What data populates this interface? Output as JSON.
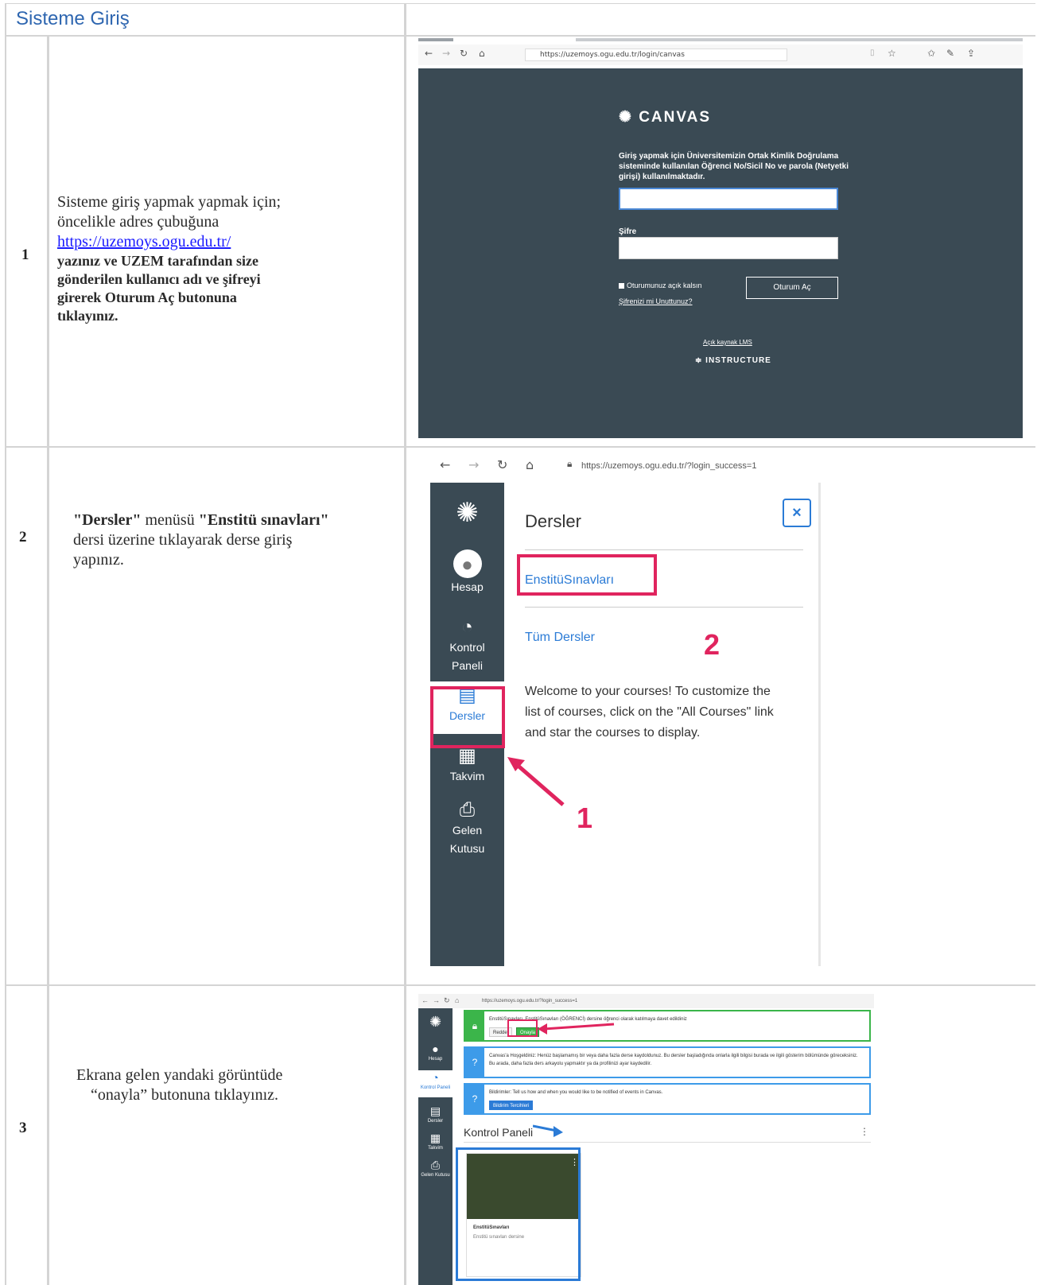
{
  "section": {
    "title": "Sisteme Giriş"
  },
  "steps": [
    {
      "number": "1"
    },
    {
      "number": "2"
    },
    {
      "number": "3"
    }
  ],
  "step1": {
    "line1": "Sisteme giriş yapmak yapmak için;",
    "line2": "öncelikle adres çubuğuna",
    "link": "https://uzemoys.ogu.edu.tr/",
    "line3": "yazınız ve UZEM tarafından size",
    "line4": "gönderilen kullanıcı adı ve şifreyi",
    "line5": "girerek Oturum Aç butonuna",
    "line6": "tıklayınız.",
    "browser": {
      "url": "https://uzemoys.ogu.edu.tr/login/canvas",
      "logo": "CANVAS",
      "description": "Giriş yapmak için Üniversitemizin Ortak Kimlik Doğrulama sisteminde kullanılan Öğrenci No/Sicil No ve parola (Netyetki girişi) kullanılmaktadır.",
      "password_label": "Şifre",
      "remember": "Oturumunuz açık kalsın",
      "forgot": "Şifrenizi mi Unuttunuz?",
      "login_button": "Oturum Aç",
      "open_lms": "Açık kaynak LMS",
      "footer": "INSTRUCTURE"
    }
  },
  "step2": {
    "q1": "\"Dersler\"",
    "t1": " menüsü ",
    "q2": "\"Enstitü sınavları\"",
    "line2": "dersi üzerine tıklayarak derse giriş",
    "line3": "yapınız.",
    "browser": {
      "url": "https://uzemoys.ogu.edu.tr/?login_success=1",
      "nav": [
        {
          "label": "Hesap"
        },
        {
          "label": "Kontrol"
        },
        {
          "label": "Paneli"
        },
        {
          "label": "Dersler"
        },
        {
          "label": "Takvim"
        },
        {
          "label": "Gelen"
        },
        {
          "label": "Kutusu"
        }
      ],
      "tray_title": "Dersler",
      "close": "×",
      "course": "EnstitüSınavları",
      "all_courses": "Tüm Dersler",
      "welcome_1": "Welcome to your courses! To customize the",
      "welcome_2": "list of courses, click on the \"All Courses\" link",
      "welcome_3": "and star the courses to display.",
      "callout_1": "1",
      "callout_2": "2"
    }
  },
  "step3": {
    "line1": "Ekrana gelen yandaki görüntüde",
    "line2": "“onayla” butonuna tıklayınız.",
    "browser": {
      "url": "https://uzemoys.ogu.edu.tr/?login_success=1",
      "n1": "EnstitüSınavları, EnstitüSınavları (ÖĞRENCİ) dersine öğrenci olarak katılmaya davet edildiniz",
      "reddet": "Reddet",
      "onayla": "Onayla",
      "n2": "Canvas'a Hoşgeldiniz: Henüz başlamamış bir veya daha fazla derse kaydoldunuz. Bu dersler başladığında onlarla ilgili bilgisi burada ve ilgili gösterim bölümünde göreceksiniz. Bu arada, daha fazla ders arkayolu yapmaktır ya da profilinizi ayar kaydedilir.",
      "n3": "Bildirimler: Tell us how and when you would like to be notified of events in Canvas.",
      "n3_btn": "Bildirim Tercihleri",
      "dash": "Kontrol Paneli",
      "card1": "EnstitüSınavları",
      "card2": "Enstitü sınavları dersine",
      "nav": [
        {
          "label": "Hesap"
        },
        {
          "label": "Kontrol Paneli"
        },
        {
          "label": "Dersler"
        },
        {
          "label": "Takvim"
        },
        {
          "label": "Gelen Kutusu"
        }
      ]
    }
  },
  "colors": {
    "accent": "#2e66b0",
    "canvas_bg": "#3a4a54",
    "highlight": "#e0245e"
  }
}
